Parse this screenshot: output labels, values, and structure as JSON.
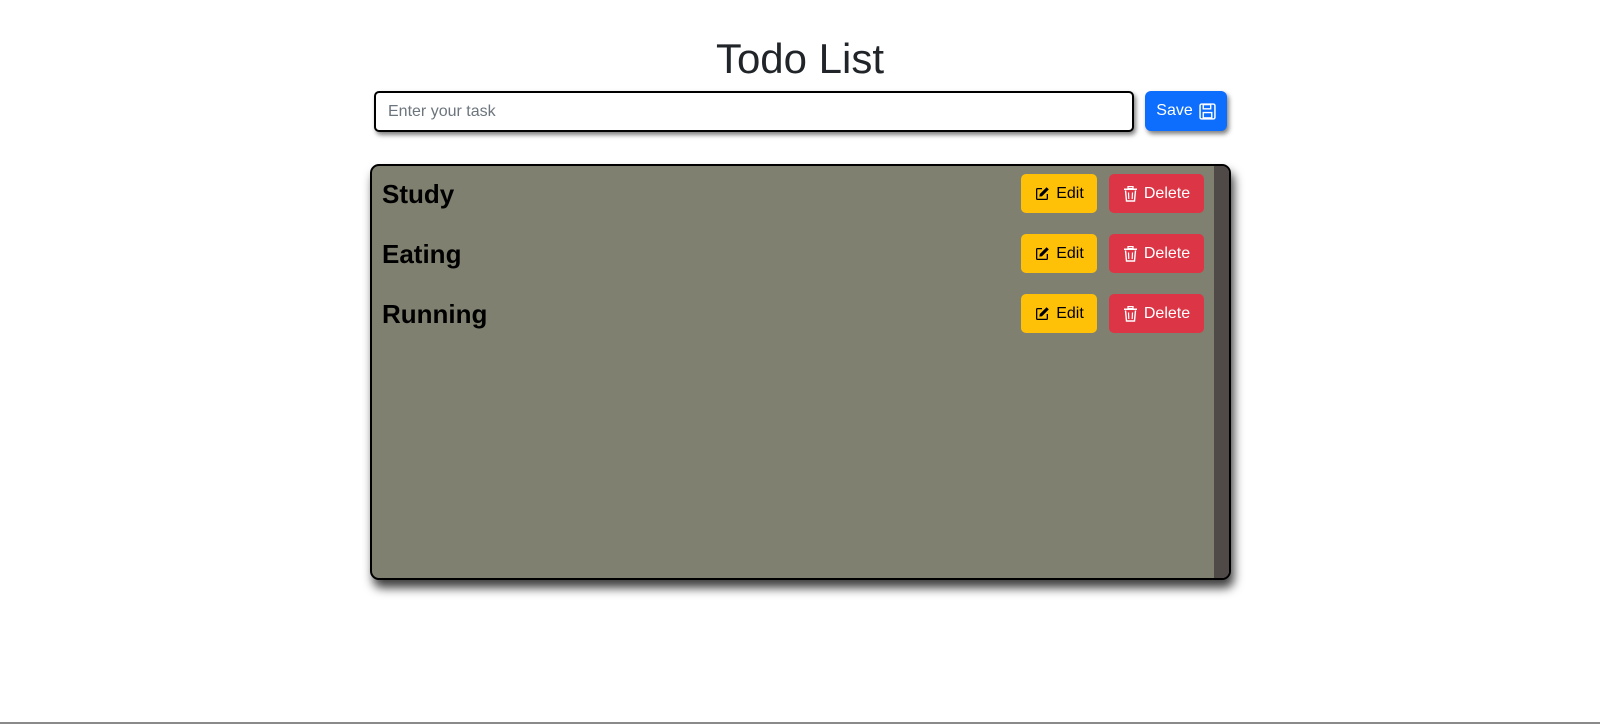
{
  "header": {
    "title": "Todo List"
  },
  "form": {
    "placeholder": "Enter your task",
    "value": "",
    "save_label": "Save",
    "save_icon": "floppy-disk-icon"
  },
  "todos": [
    {
      "text": "Study",
      "edit_label": "Edit",
      "delete_label": "Delete"
    },
    {
      "text": "Eating",
      "edit_label": "Edit",
      "delete_label": "Delete"
    },
    {
      "text": "Running",
      "edit_label": "Edit",
      "delete_label": "Delete"
    }
  ],
  "icons": {
    "edit": "pencil-square-icon",
    "delete": "trash-icon"
  },
  "colors": {
    "primary": "#0d6efd",
    "warning": "#ffc107",
    "danger": "#dc3545",
    "panel": "#808070",
    "scrollbar": "#4f4a48"
  }
}
